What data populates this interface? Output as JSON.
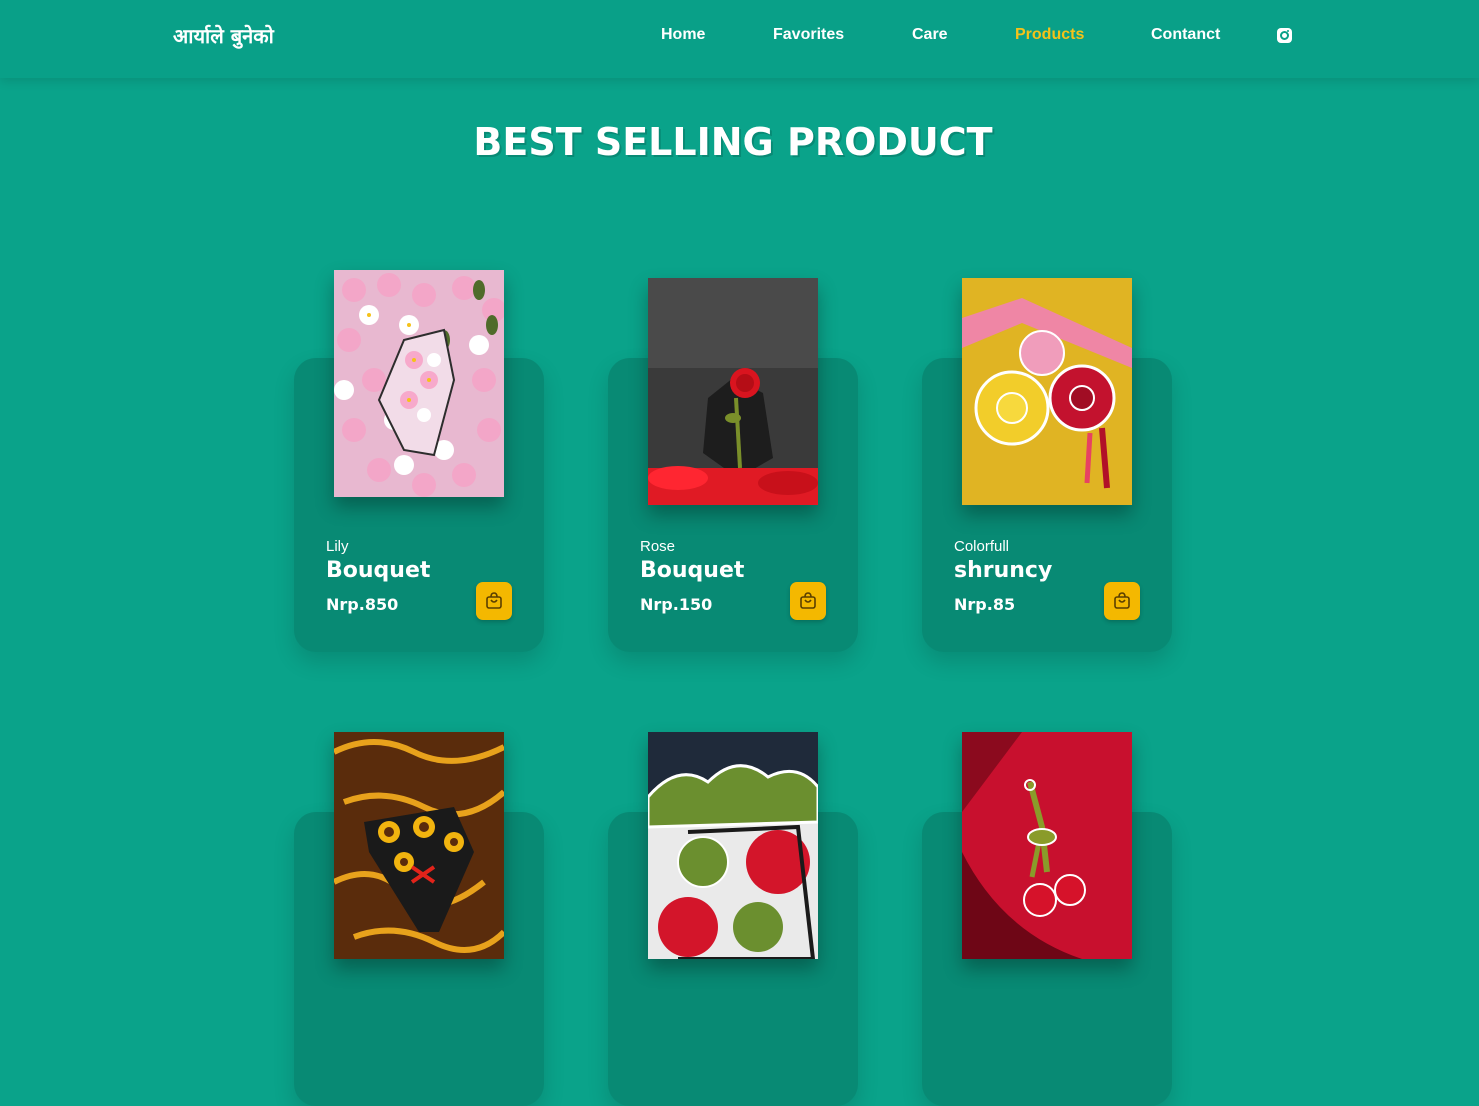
{
  "header": {
    "brand": "आर्याले बुनेको",
    "nav": [
      {
        "label": "Home",
        "active": false
      },
      {
        "label": "Favorites",
        "active": false
      },
      {
        "label": "Care",
        "active": false
      },
      {
        "label": "Products",
        "active": true
      },
      {
        "label": "Contanct",
        "active": false
      }
    ],
    "social_icon": "instagram-icon"
  },
  "section": {
    "title": "BEST SELLING PRODUCT"
  },
  "products": [
    {
      "subtitle": "Lily",
      "name": "Bouquet",
      "price": "Nrp.850",
      "image": "pink-lily-crochet-bouquet"
    },
    {
      "subtitle": "Rose",
      "name": "Bouquet",
      "price": "Nrp.150",
      "image": "single-red-rose-crochet"
    },
    {
      "subtitle": "Colorfull",
      "name": "shruncy",
      "price": "Nrp.85",
      "image": "colorful-crochet-scrunchies"
    },
    {
      "image": "sunflower-crochet-bouquet"
    },
    {
      "image": "red-green-crochet-bouquet"
    },
    {
      "image": "cherry-crochet-keychain"
    }
  ],
  "colors": {
    "background": "#0aa38a",
    "card": "#088a74",
    "accent": "#f5c219",
    "cart_button": "#f4b800",
    "text": "#ffffff"
  }
}
